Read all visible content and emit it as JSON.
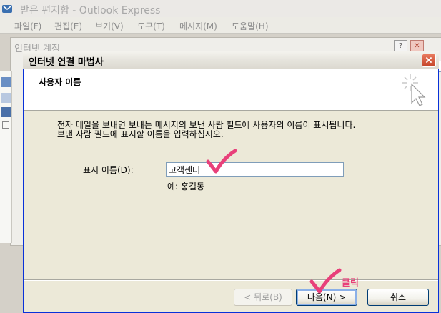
{
  "background_window": {
    "title": "받은 편지함 - Outlook Express",
    "menu": [
      "파일(F)",
      "편집(E)",
      "보기(V)",
      "도구(T)",
      "메시지(M)",
      "도움말(H)"
    ],
    "inner_panel_title": "인터넷 계정",
    "inner_help_label": "?"
  },
  "wizard": {
    "title": "인터넷 연결 마법사",
    "header_title": "사용자 이름",
    "description_line1": "전자 메일을 보내면 보내는 메시지의 보낸 사람 필드에 사용자의 이름이 표시됩니다.",
    "description_line2": "보낸 사람 필드에 표시할 이름을 입력하십시오.",
    "display_name_label": "표시 이름(D):",
    "display_name_value": "고객센터",
    "display_name_example": "예: 홍길동",
    "back_label": "< 뒤로(B)",
    "next_label": "다음(N) >",
    "cancel_label": "취소"
  },
  "annotation": {
    "click_label": "클릭",
    "accent_color": "#e8407a"
  },
  "colors": {
    "dialog_border": "#0831d9",
    "close_button": "#c4452a",
    "dialog_face": "#ece9d8"
  },
  "icons": [
    "outlook-app-icon",
    "close-icon",
    "help-icon",
    "wizard-cursor-icon",
    "checkmark-icon"
  ]
}
